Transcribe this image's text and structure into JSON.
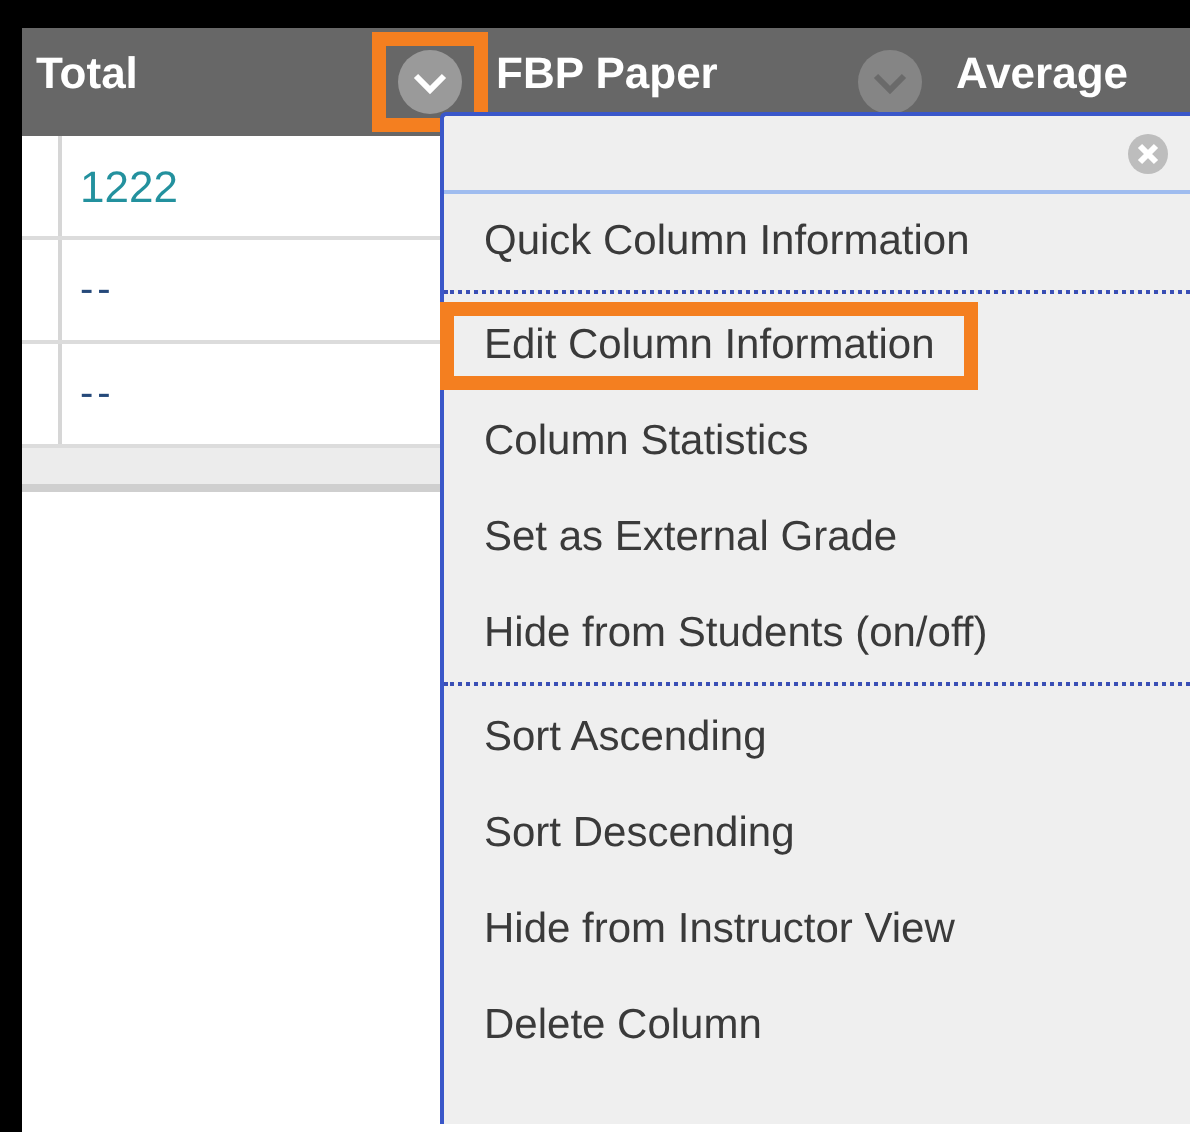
{
  "table": {
    "columns": [
      {
        "label": "Total",
        "menu_button": false,
        "highlighted": false
      },
      {
        "label": "FBP Paper",
        "menu_button": true,
        "highlighted": true
      },
      {
        "label": "Average",
        "menu_button": true,
        "highlighted": false
      }
    ],
    "rows": [
      {
        "total": "1222",
        "kind": "link"
      },
      {
        "total": "--",
        "kind": "text"
      },
      {
        "total": "--",
        "kind": "text"
      }
    ]
  },
  "menu": {
    "sections": [
      [
        {
          "label": "Quick Column Information",
          "highlighted": false
        }
      ],
      [
        {
          "label": "Edit Column Information",
          "highlighted": true
        },
        {
          "label": "Column Statistics",
          "highlighted": false
        },
        {
          "label": "Set as External Grade",
          "highlighted": false
        },
        {
          "label": "Hide from Students (on/off)",
          "highlighted": false
        }
      ],
      [
        {
          "label": "Sort Ascending",
          "highlighted": false
        },
        {
          "label": "Sort Descending",
          "highlighted": false
        },
        {
          "label": "Hide from Instructor View",
          "highlighted": false
        },
        {
          "label": "Delete Column",
          "highlighted": false
        }
      ]
    ]
  }
}
